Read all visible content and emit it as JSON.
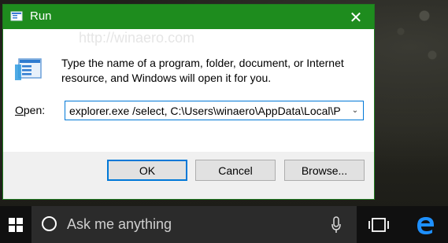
{
  "dialog": {
    "title": "Run",
    "close_glyph": "✕",
    "description": "Type the name of a program, folder, document, or Internet resource, and Windows will open it for you.",
    "open_label_prefix": "O",
    "open_label_rest": "pen:",
    "open_value": "explorer.exe /select, C:\\Users\\winaero\\AppData\\Local\\P",
    "buttons": {
      "ok": "OK",
      "cancel": "Cancel",
      "browse": "Browse..."
    }
  },
  "taskbar": {
    "search_placeholder": "Ask me anything"
  },
  "watermark": "http://winaero.com",
  "colors": {
    "titlebar": "#1e8c1e",
    "accent": "#0078d7",
    "taskbar": "#101010",
    "search_box": "#2b2b2b",
    "edge_blue": "#1e90ff"
  }
}
